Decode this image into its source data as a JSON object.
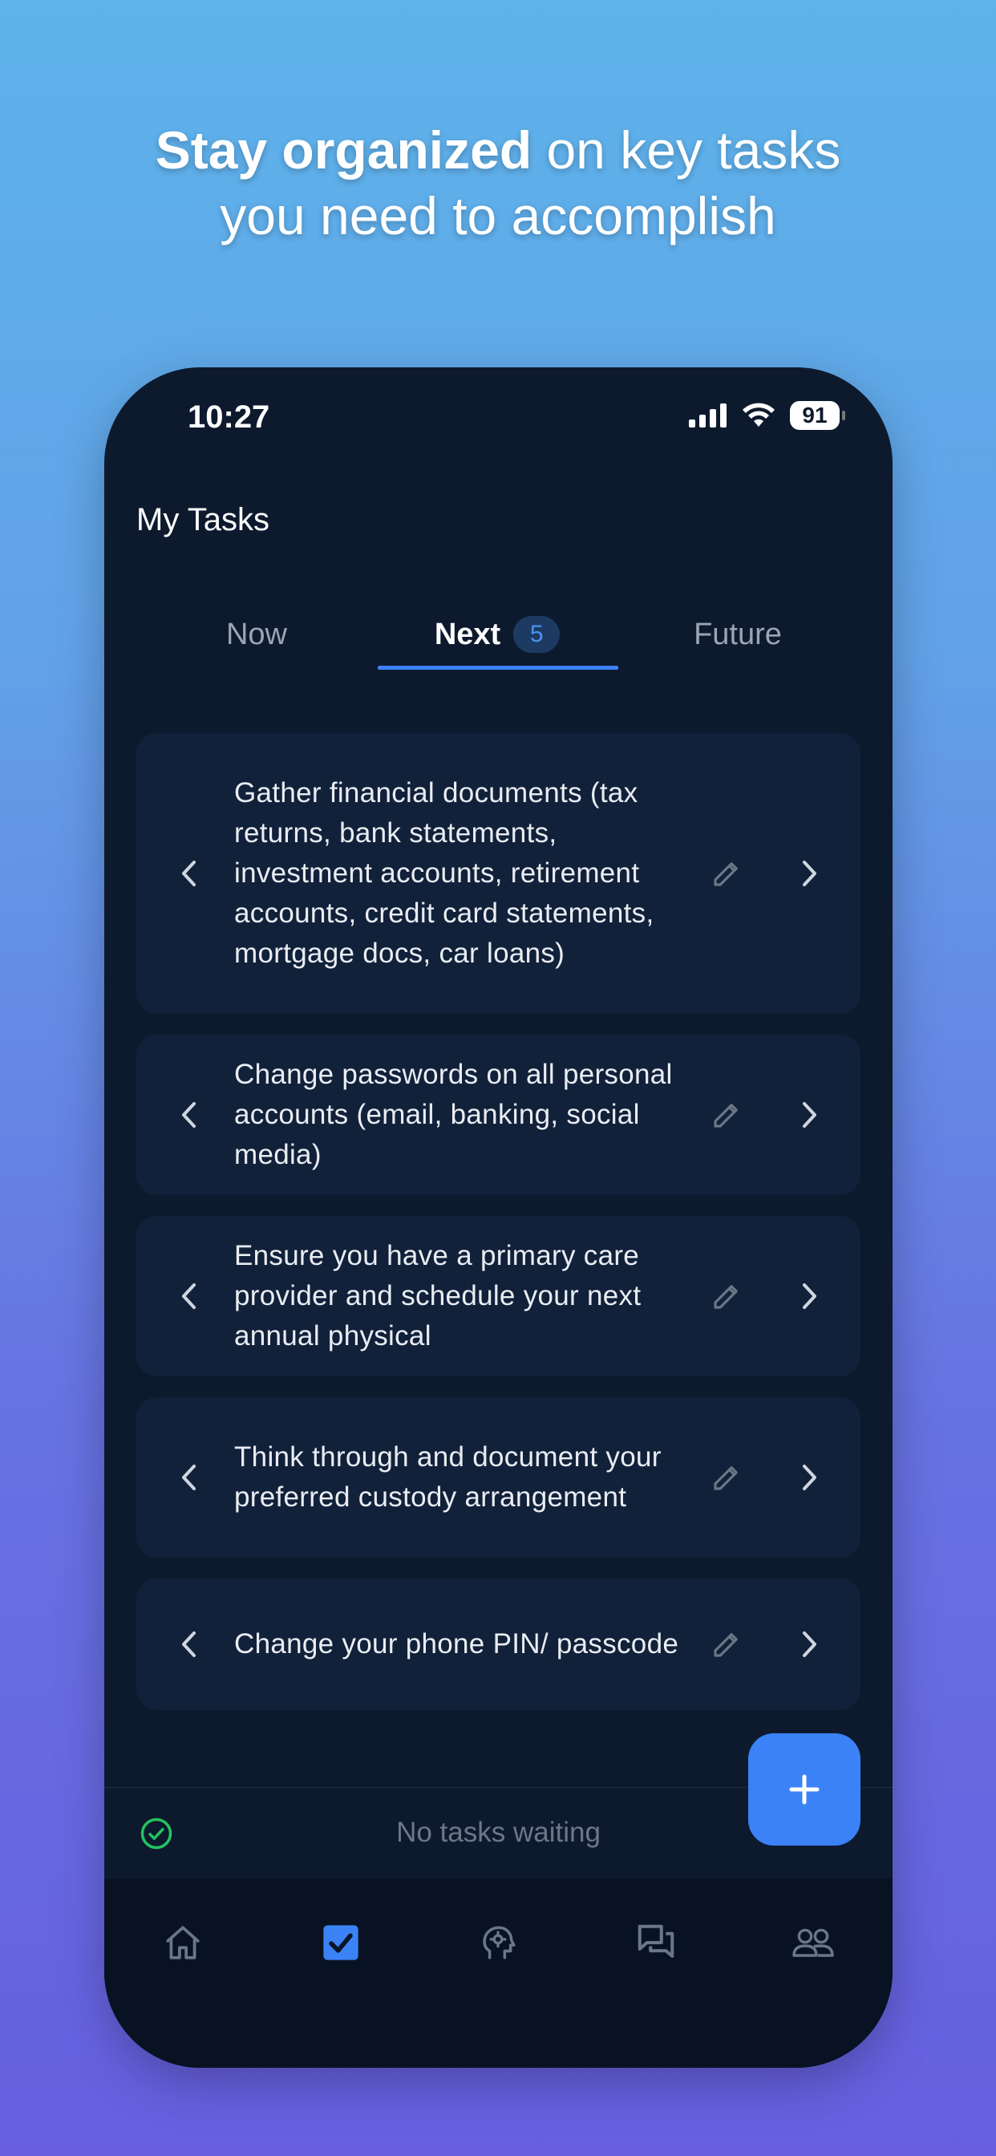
{
  "headline": {
    "bold": "Stay organized",
    "rest_line1": " on key tasks",
    "line2": "you need to accomplish"
  },
  "status": {
    "time": "10:27",
    "battery": "91"
  },
  "page": {
    "title": "My Tasks"
  },
  "tabs": [
    {
      "label": "Now",
      "active": false
    },
    {
      "label": "Next",
      "active": true,
      "badge": "5"
    },
    {
      "label": "Future",
      "active": false
    }
  ],
  "tasks": [
    {
      "text": "Gather financial documents (tax returns, bank statements, investment accounts, retirement accounts, credit card statements, mortgage docs, car loans)"
    },
    {
      "text": "Change passwords on all personal accounts (email, banking, social media)"
    },
    {
      "text": "Ensure you have a primary care provider and schedule your next annual physical"
    },
    {
      "text": "Think through and document your preferred custody arrangement"
    },
    {
      "text": "Change your phone PIN/ passcode"
    }
  ],
  "waiting": {
    "text": "No tasks waiting"
  },
  "colors": {
    "accent": "#3b82f6",
    "success": "#22c55e",
    "background": "#0d1a2e"
  },
  "nav": [
    {
      "icon": "home-icon",
      "active": false
    },
    {
      "icon": "tasks-checkbox-icon",
      "active": true
    },
    {
      "icon": "mind-gear-icon",
      "active": false
    },
    {
      "icon": "chat-icon",
      "active": false
    },
    {
      "icon": "people-icon",
      "active": false
    }
  ]
}
